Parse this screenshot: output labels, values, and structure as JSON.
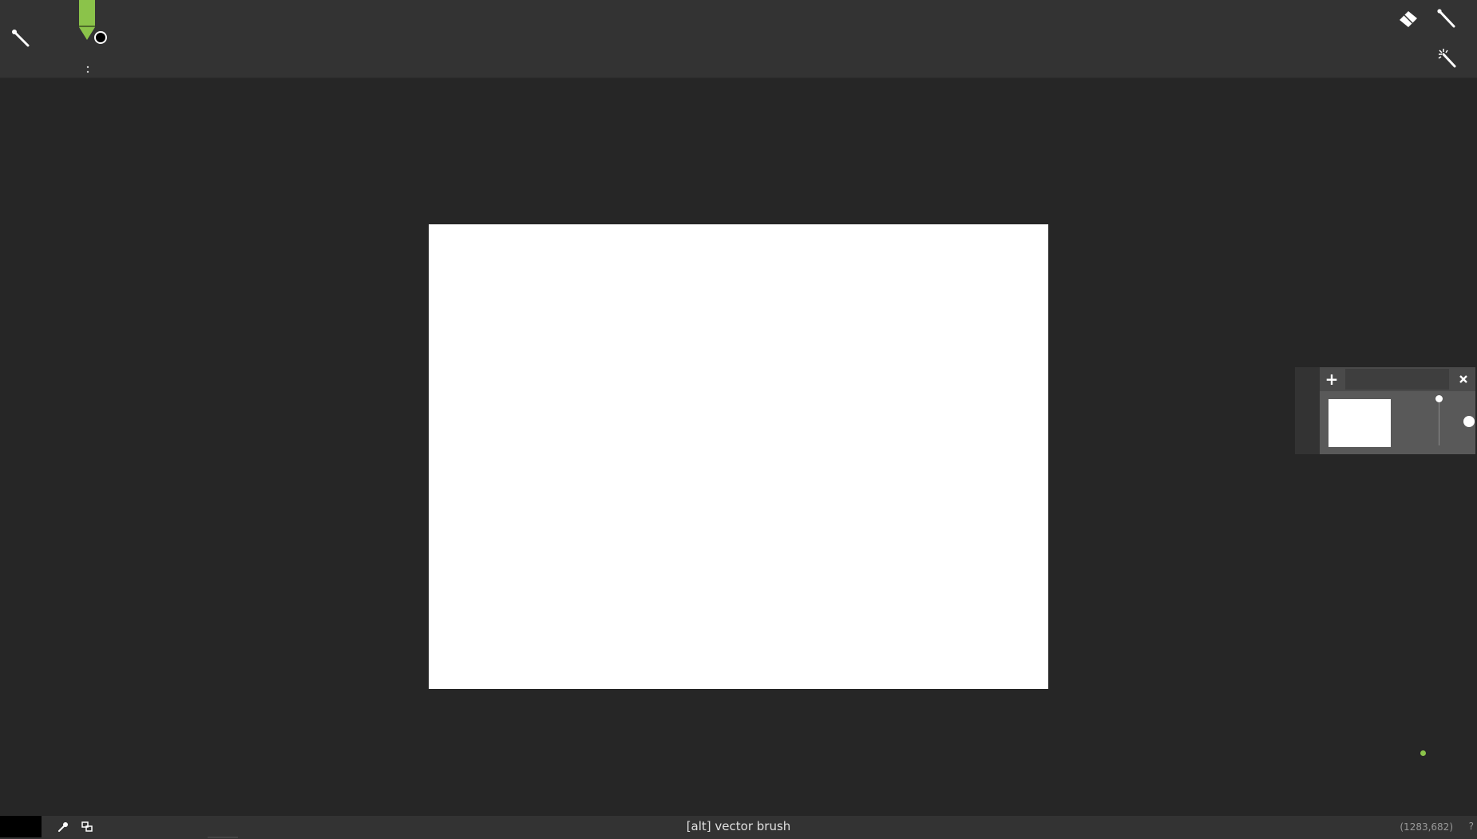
{
  "toolbar": {
    "tools": [
      "brush-icon",
      "eraser-icon",
      "pen-icon",
      "magic-wand-icon"
    ],
    "brush_color": "#8bc34a",
    "size_dots": ":"
  },
  "layers_panel": {
    "add_label": "+",
    "layer_name": "",
    "layers": [
      {
        "thumbnail_color": "#ffffff",
        "opacity": 1.0,
        "visible": true
      }
    ]
  },
  "statusbar": {
    "current_color": "#000000",
    "hint": "[alt] vector brush",
    "coords": "(1283,682)",
    "help_label": "?"
  },
  "canvas": {
    "background": "#ffffff"
  }
}
